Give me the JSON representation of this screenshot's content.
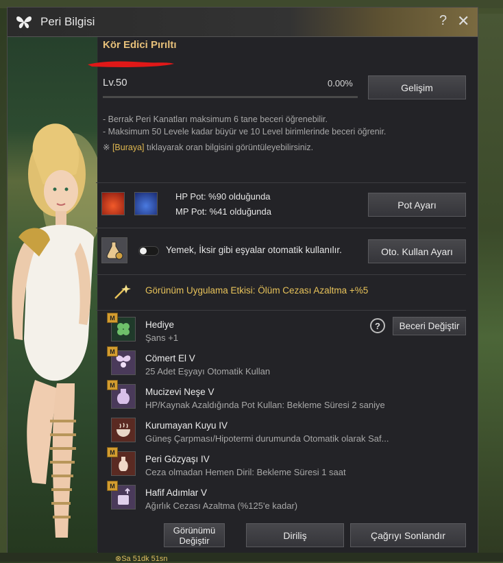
{
  "window": {
    "title": "Peri Bilgisi",
    "help": "?",
    "close": "✕"
  },
  "fairy": {
    "name": "Kör Edici Pırıltı",
    "level": "Lv.50",
    "xp": "0.00%"
  },
  "buttons": {
    "growth": "Gelişim",
    "pot_settings": "Pot Ayarı",
    "auto_use_settings": "Oto. Kullan Ayarı",
    "change_skill": "Beceri Değiştir",
    "change_appearance": "Görünümü Değiştir",
    "revive": "Diriliş",
    "end_summon": "Çağrıyı Sonlandır"
  },
  "info": {
    "line1": "- Berrak Peri Kanatları maksimum 6 tane beceri öğrenebilir.",
    "line2": "- Maksimum 50 Levele kadar büyür ve 10 Level birimlerinde beceri öğrenir.",
    "line3_prefix": "※ ",
    "line3_link": "[Buraya]",
    "line3_suffix": " tıklayarak oran bilgisini görüntüleyebilirsiniz."
  },
  "pots": {
    "hp": "HP Pot: %90 olduğunda",
    "mp": "MP Pot: %41 olduğunda"
  },
  "auto_use": {
    "text": "Yemek, İksir gibi eşyalar otomatik kullanılır.",
    "toggle_on": false
  },
  "effect": {
    "text": "Görünüm Uygulama Etkisi: Ölüm Cezası Azaltma +%5"
  },
  "skills": [
    {
      "name": "Hediye",
      "desc": "Şans +1",
      "badge": "M",
      "icon": "clover-icon"
    },
    {
      "name": "Cömert El V",
      "desc": "25 Adet Eşyayı Otomatik Kullan",
      "badge": "M",
      "icon": "fairy-icon"
    },
    {
      "name": "Mucizevi Neşe V",
      "desc": "HP/Kaynak Azaldığında Pot Kullan: Bekleme Süresi 2 saniye",
      "badge": "M",
      "icon": "potion-icon"
    },
    {
      "name": "Kurumayan Kuyu IV",
      "desc": "Güneş Çarpması/Hipotermi durumunda Otomatik olarak Saf...",
      "badge": "",
      "icon": "bowl-icon"
    },
    {
      "name": "Peri Gözyaşı IV",
      "desc": "Ceza olmadan Hemen Diril: Bekleme Süresi 1 saat",
      "badge": "M",
      "icon": "tear-vial-icon"
    },
    {
      "name": "Hafif Adımlar V",
      "desc": "Ağırlık Cezası Azaltma (%125'e kadar)",
      "badge": "M",
      "icon": "weight-icon"
    }
  ],
  "background": {
    "timer": "⊗Sa 51dk 51sn"
  },
  "colors": {
    "accent": "#e7c07a",
    "effect": "#e8c35a",
    "badge": "#d39c2f",
    "panel": "#232327"
  }
}
